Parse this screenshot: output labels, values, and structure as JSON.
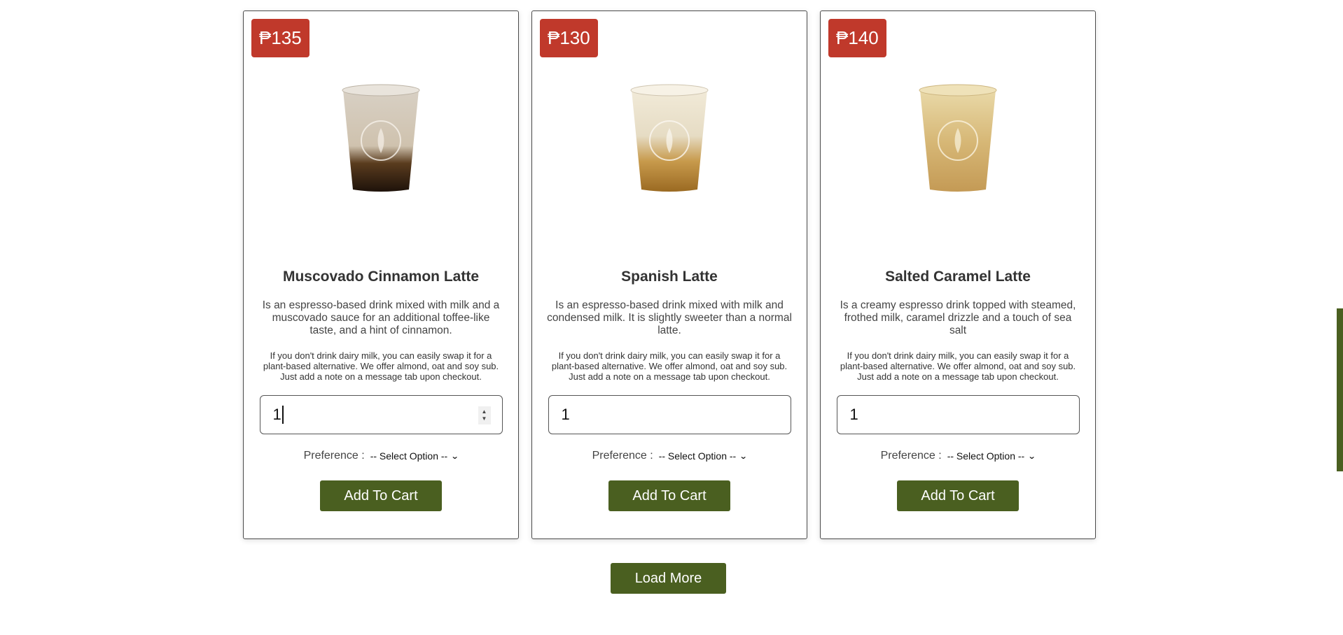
{
  "colors": {
    "accent": "#4a5f20",
    "price_badge": "#c0392b",
    "card_border": "#4a4a4a"
  },
  "products": [
    {
      "price": "₱135",
      "name": "Muscovado Cinnamon Latte",
      "description": "Is an espresso-based drink mixed with milk and a muscovado sauce for an additional toffee-like taste, and a hint of cinnamon.",
      "note": "If you don't drink dairy milk, you can easily swap it for a plant-based alternative. We offer almond, oat and soy sub. Just add a note on a message tab upon checkout.",
      "quantity": "1",
      "preference_label": "Preference :",
      "preference_value": "-- Select Option --",
      "button_label": "Add To Cart",
      "image_icon": "iced-latte-cup-dark-icon"
    },
    {
      "price": "₱130",
      "name": "Spanish Latte",
      "description": "Is an espresso-based drink mixed with milk and condensed milk. It is slightly sweeter than a normal latte.",
      "note": "If you don't drink dairy milk, you can easily swap it for a plant-based alternative. We offer almond, oat and soy sub. Just add a note on a message tab upon checkout.",
      "quantity": "1",
      "preference_label": "Preference :",
      "preference_value": "-- Select Option --",
      "button_label": "Add To Cart",
      "image_icon": "iced-latte-cup-amber-icon"
    },
    {
      "price": "₱140",
      "name": "Salted Caramel Latte",
      "description": "Is a creamy espresso drink topped with steamed, frothed milk, caramel drizzle and a touch of sea salt",
      "note": "If you don't drink dairy milk, you can easily swap it for a plant-based alternative. We offer almond, oat and soy sub. Just add a note on a message tab upon checkout.",
      "quantity": "1",
      "preference_label": "Preference :",
      "preference_value": "-- Select Option --",
      "button_label": "Add To Cart",
      "image_icon": "iced-latte-cup-caramel-icon"
    }
  ],
  "load_more_label": "Load More"
}
